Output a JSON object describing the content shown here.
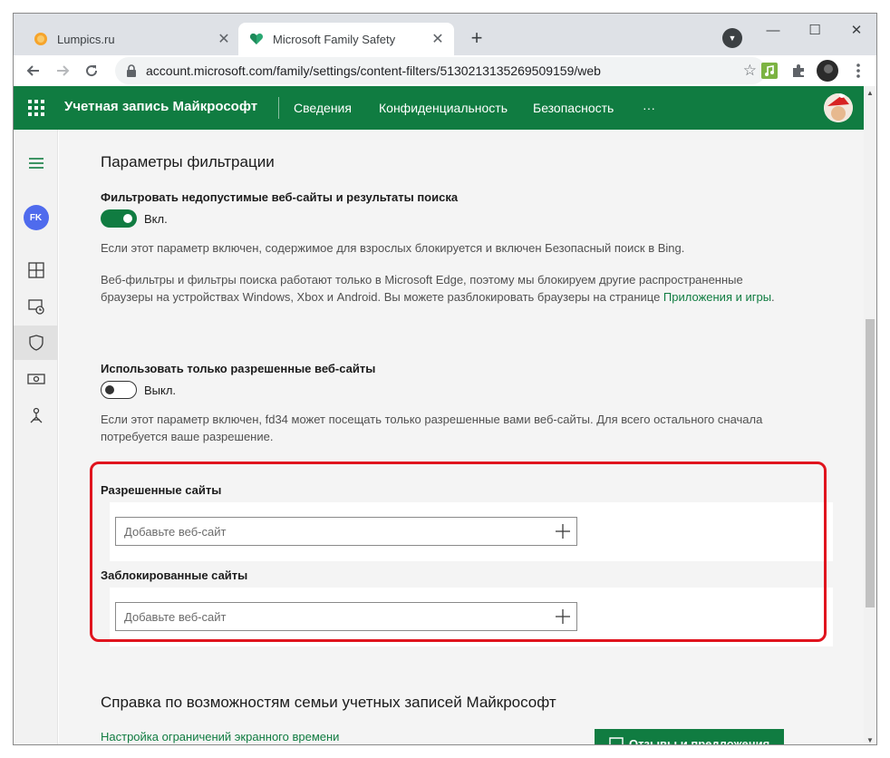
{
  "browser": {
    "tabs": [
      {
        "title": "Lumpics.ru",
        "active": false
      },
      {
        "title": "Microsoft Family Safety",
        "active": true
      }
    ],
    "close_glyph": "✕",
    "new_tab_glyph": "+",
    "url": "account.microsoft.com/family/settings/content-filters/5130213135269509159/web",
    "window_controls": {
      "minimize": "—",
      "maximize": "☐",
      "close": "✕"
    }
  },
  "header": {
    "brand": "Учетная запись Майкрософт",
    "nav": [
      "Сведения",
      "Конфиденциальность",
      "Безопасность",
      "···"
    ]
  },
  "sidebar": {
    "avatar_initials": "FK"
  },
  "filters": {
    "title": "Параметры фильтрации",
    "inappropriate": {
      "label": "Фильтровать недопустимые веб-сайты и результаты поиска",
      "state_label": "Вкл.",
      "on": true,
      "desc1": "Если этот параметр включен, содержимое для взрослых блокируется и включен Безопасный поиск в Bing.",
      "desc2": "Веб-фильтры и фильтры поиска работают только в Microsoft Edge, поэтому мы блокируем другие распространенные браузеры на устройствах Windows, Xbox и Android. Вы можете разблокировать браузеры на странице ",
      "desc2_link": "Приложения и игры",
      "desc2_end": "."
    },
    "allowed_only": {
      "label": "Использовать только разрешенные веб-сайты",
      "state_label": "Выкл.",
      "on": false,
      "desc": "Если этот параметр включен, fd34 может посещать только разрешенные вами веб-сайты. Для всего остального сначала потребуется ваше разрешение."
    },
    "allowed_sites": {
      "title": "Разрешенные сайты",
      "placeholder": "Добавьте веб-сайт"
    },
    "blocked_sites": {
      "title": "Заблокированные сайты",
      "placeholder": "Добавьте веб-сайт"
    }
  },
  "help": {
    "title": "Справка по возможностям семьи учетных записей Майкрософт",
    "link": "Настройка ограничений экранного времени",
    "feedback_button": "Отзывы и предложения"
  },
  "colors": {
    "brand_green": "#107c41",
    "highlight_red": "#e0141e"
  }
}
